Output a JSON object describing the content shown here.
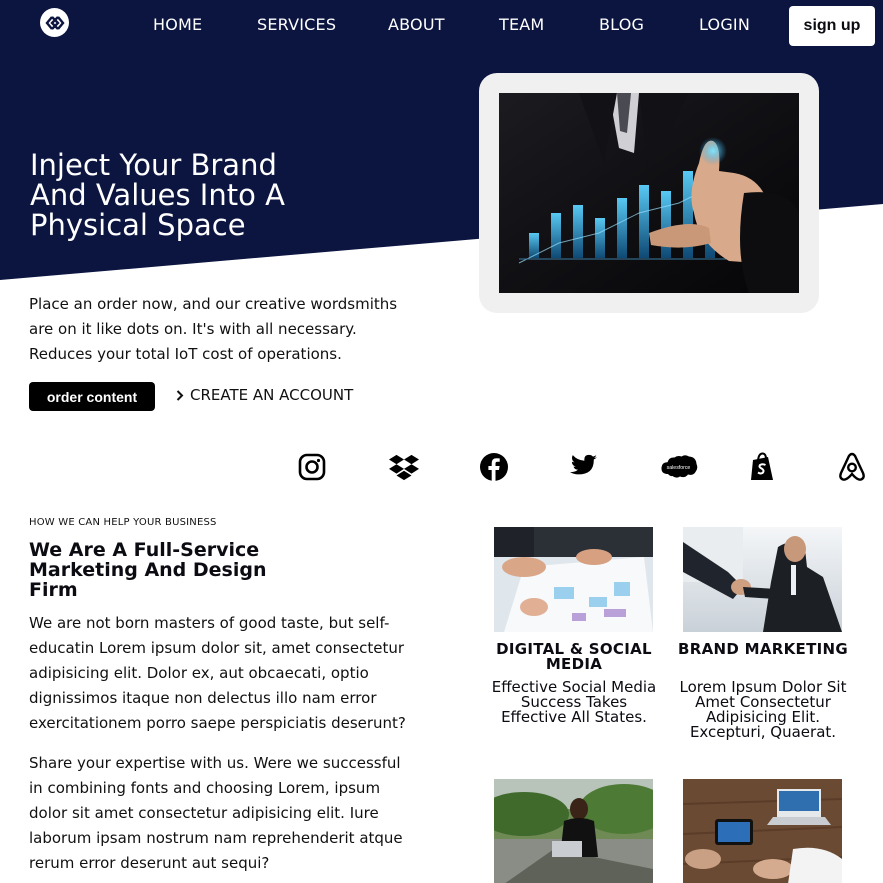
{
  "nav": {
    "logo_icon": "diamond-link-logo",
    "items": [
      "HOME",
      "SERVICES",
      "ABOUT",
      "TEAM",
      "BLOG",
      "LOGIN"
    ],
    "signup_label": "sign up"
  },
  "hero": {
    "title": "Inject Your Brand And Values Into A Physical Space",
    "description": "Place an order now, and our creative wordsmiths are on it like dots on. It's with all necessary. Reduces your total IoT cost of operations.",
    "order_label": "order content",
    "create_account_label": "CREATE AN ACCOUNT",
    "image_icon": "business-growth-chart-image"
  },
  "brands": [
    "instagram-icon",
    "dropbox-icon",
    "facebook-icon",
    "twitter-icon",
    "salesforce-icon",
    "shopify-icon",
    "airbnb-icon"
  ],
  "brand_labels": {
    "salesforce": "salesforce"
  },
  "services": {
    "eyebrow": "HOW WE CAN HELP YOUR BUSINESS",
    "title": "We Are A Full-Service Marketing And Design Firm",
    "paragraphs": [
      "We are not born masters of good taste, but self-educatin Lorem ipsum dolor sit, amet consectetur adipisicing elit. Dolor ex, aut obcaecati, optio dignissimos itaque non delectus illo nam error exercitationem porro saepe perspiciatis deserunt?",
      "Share your expertise with us. Were we successful in combining fonts and choosing Lorem, ipsum dolor sit amet consectetur adipisicing elit. Iure laborum ipsam nostrum nam reprehenderit atque rerum error deserunt aut sequi?"
    ],
    "cards": [
      {
        "title": "DIGITAL & SOCIAL MEDIA",
        "text": "Effective Social Media Success Takes Effective All States.",
        "image": "team-meeting-charts-photo"
      },
      {
        "title": "BRAND MARKETING",
        "text": "Lorem Ipsum Dolor Sit Amet Consectetur Adipisicing Elit. Excepturi, Quaerat.",
        "image": "business-handshake-photo"
      },
      {
        "title": "",
        "text": "",
        "image": "woman-with-laptop-photo"
      },
      {
        "title": "",
        "text": "",
        "image": "laptop-tablet-desk-photo"
      }
    ]
  },
  "colors": {
    "navy": "#0c1540",
    "black": "#000000",
    "white": "#ffffff",
    "chart_blue": "#2aa6e8"
  }
}
